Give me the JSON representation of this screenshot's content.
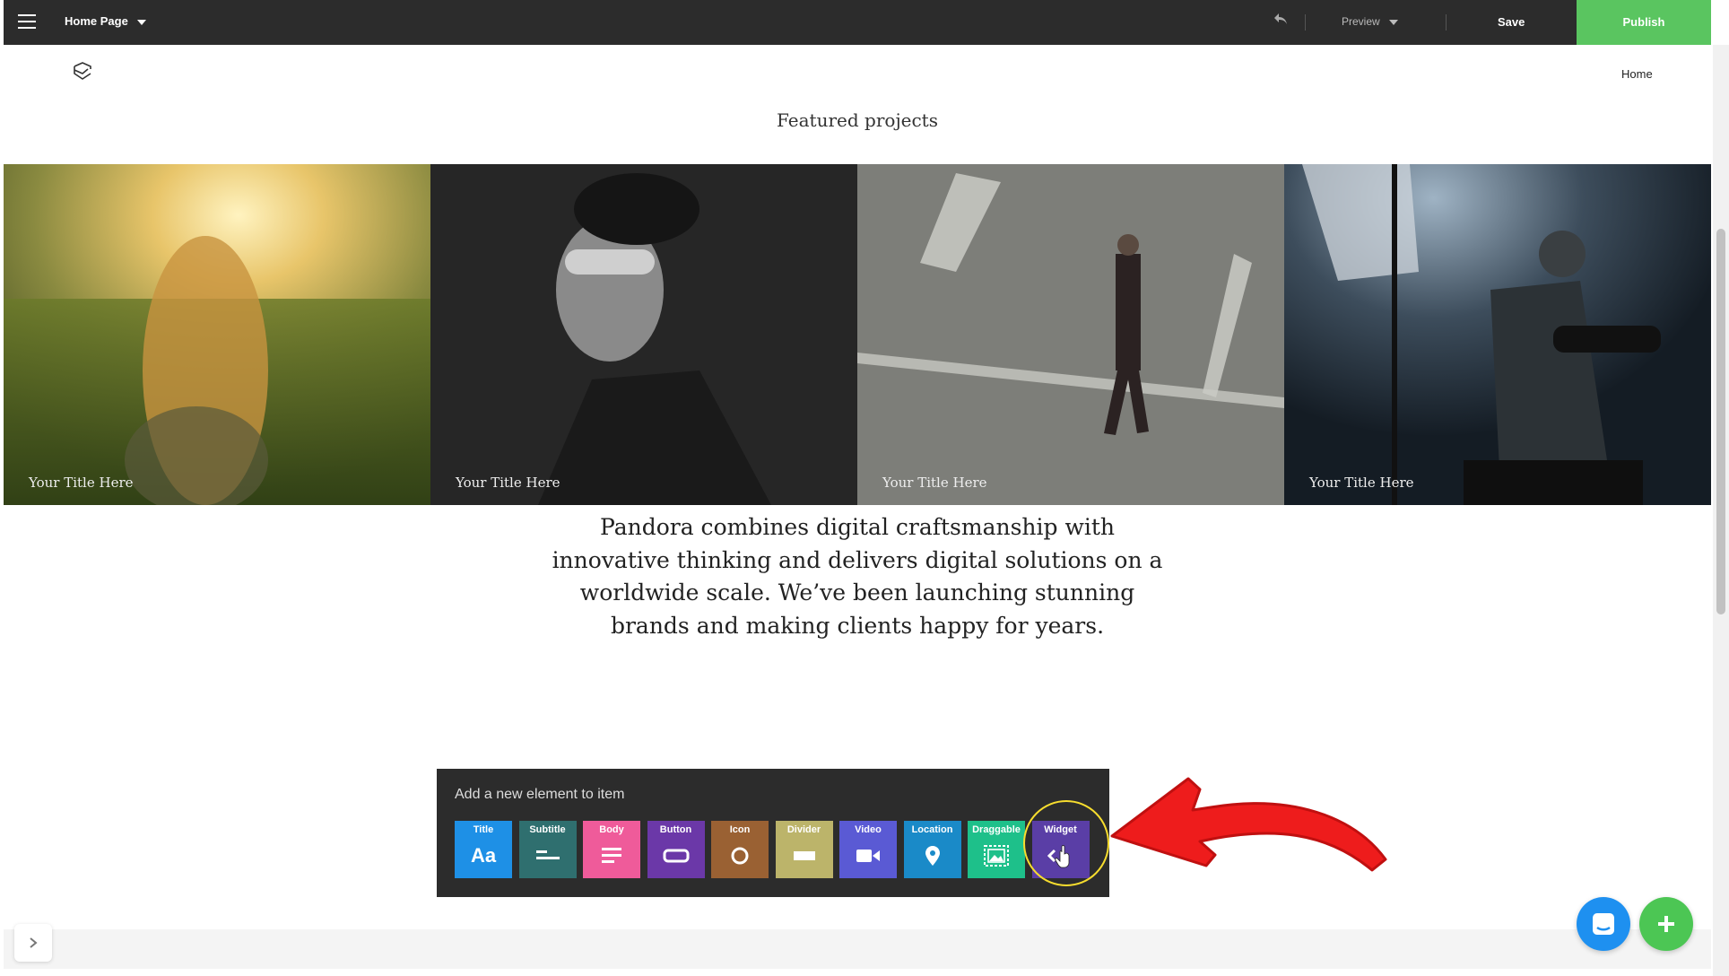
{
  "topbar": {
    "page_name": "Home Page",
    "preview_label": "Preview",
    "save_label": "Save",
    "publish_label": "Publish"
  },
  "site": {
    "nav_home": "Home",
    "section_title": "Featured projects",
    "tiles": [
      {
        "caption": "Your Title Here"
      },
      {
        "caption": "Your Title Here"
      },
      {
        "caption": "Your Title Here"
      },
      {
        "caption": "Your Title Here"
      }
    ],
    "about_text": "Pandora combines digital craftsmanship with innovative thinking and delivers digital solutions on a worldwide scale. We’ve been launching stunning brands and making clients happy for years."
  },
  "panel": {
    "heading": "Add a new element to item",
    "chips": [
      {
        "label": "Title",
        "icon": "text-icon",
        "glyph": "Aa",
        "color": "#1e90e6"
      },
      {
        "label": "Subtitle",
        "icon": "subtitle-icon",
        "color": "#2f6f6f"
      },
      {
        "label": "Body",
        "icon": "paragraph-icon",
        "color": "#ef5b9a"
      },
      {
        "label": "Button",
        "icon": "button-icon",
        "color": "#6b38a8"
      },
      {
        "label": "Icon",
        "icon": "circle-icon",
        "color": "#9a6133"
      },
      {
        "label": "Divider",
        "icon": "divider-icon",
        "color": "#bcb46a"
      },
      {
        "label": "Video",
        "icon": "video-camera-icon",
        "color": "#5a5ad4"
      },
      {
        "label": "Location",
        "icon": "map-pin-icon",
        "color": "#1a8ac8"
      },
      {
        "label": "Draggable",
        "icon": "image-icon",
        "color": "#1ec08a"
      },
      {
        "label": "Widget",
        "icon": "code-icon",
        "color": "#5a3ea6"
      }
    ]
  },
  "colors": {
    "topbar_bg": "#2c2c2c",
    "publish_green": "#5ac560",
    "highlight_yellow": "#f7dd2e",
    "arrow_red": "#ee1c1c",
    "chat_blue": "#1e90f0",
    "add_green": "#4cc654"
  }
}
